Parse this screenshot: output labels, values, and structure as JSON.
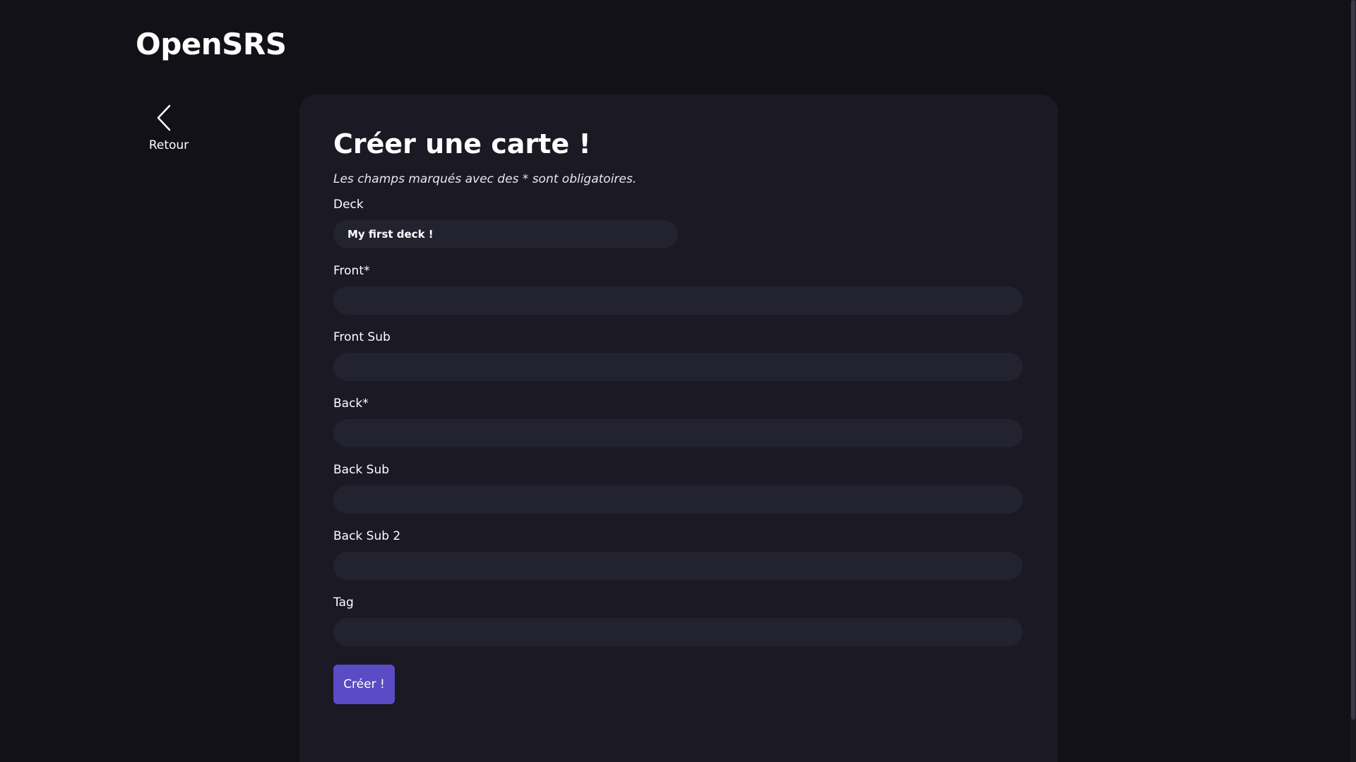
{
  "header": {
    "brand": "OpenSRS"
  },
  "nav": {
    "back_label": "Retour",
    "back_icon": "chevron-left-icon"
  },
  "form": {
    "title": "Créer une carte !",
    "required_note": "Les champs marqués avec des * sont obligatoires.",
    "fields": [
      {
        "label": "Deck",
        "value": "My first deck !",
        "type": "select"
      },
      {
        "label": "Front*",
        "value": ""
      },
      {
        "label": "Front Sub",
        "value": ""
      },
      {
        "label": "Back*",
        "value": ""
      },
      {
        "label": "Back Sub",
        "value": ""
      },
      {
        "label": "Back Sub 2",
        "value": ""
      },
      {
        "label": "Tag",
        "value": ""
      }
    ],
    "submit_label": "Créer !"
  },
  "colors": {
    "background": "#121118",
    "card": "#1a1924",
    "input": "#23222f",
    "accent": "#5b4bc4"
  }
}
